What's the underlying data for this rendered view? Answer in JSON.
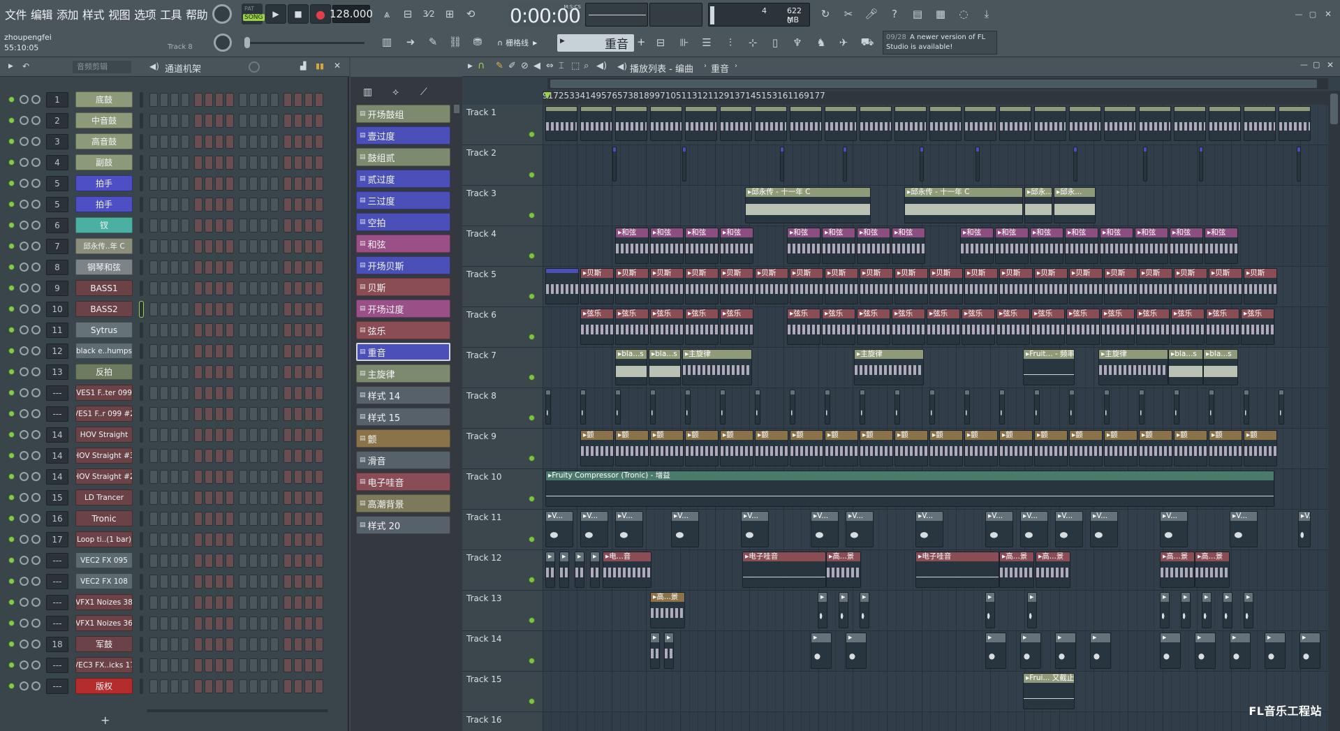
{
  "menu": [
    "文件",
    "编辑",
    "添加",
    "样式",
    "视图",
    "选项",
    "工具",
    "帮助"
  ],
  "transport": {
    "mode_label": "SONG",
    "tempo": "128.000",
    "time": "0:00:00",
    "time_unit": "M:S:CS",
    "cpu": "4",
    "mem": "622 MB",
    "poly": "0"
  },
  "project": {
    "user": "zhoupengfei",
    "elapsed": "55:10:05",
    "hint": "Track 8"
  },
  "toolbar2": {
    "snap": "栅格线",
    "pattern": "重音",
    "news_date": "09/28",
    "news_text_1": "A newer version of FL",
    "news_text_2": "Studio is available!"
  },
  "rack": {
    "filter": "音频剪辑",
    "title": "通道机架"
  },
  "channels": [
    {
      "num": "1",
      "name": "底鼓",
      "color": "#8c9a7a"
    },
    {
      "num": "2",
      "name": "中音鼓",
      "color": "#8c9a7a"
    },
    {
      "num": "3",
      "name": "高音鼓",
      "color": "#8c9a7a"
    },
    {
      "num": "4",
      "name": "副鼓",
      "color": "#8c9a7a"
    },
    {
      "num": "5",
      "name": "拍手",
      "color": "#4e4fc4"
    },
    {
      "num": "5",
      "name": "拍手",
      "color": "#4e4fc4"
    },
    {
      "num": "6",
      "name": "钗",
      "color": "#4bb0a2"
    },
    {
      "num": "7",
      "name": "邱永传..年 C",
      "color": "#8a8f7c"
    },
    {
      "num": "8",
      "name": "钢琴和弦",
      "color": "#7c8488"
    },
    {
      "num": "9",
      "name": "BASS1",
      "color": "#6b4347"
    },
    {
      "num": "10",
      "name": "BASS2",
      "color": "#6b4347"
    },
    {
      "num": "11",
      "name": "Sytrus",
      "color": "#657379"
    },
    {
      "num": "12",
      "name": "black e..humps",
      "color": "#5f6c71"
    },
    {
      "num": "13",
      "name": "反拍",
      "color": "#6f7b61"
    },
    {
      "num": "---",
      "name": "VES1 F..ter 099",
      "color": "#6b4347"
    },
    {
      "num": "---",
      "name": "VES1 F..r 099 #2",
      "color": "#6b4347"
    },
    {
      "num": "14",
      "name": "HOV Straight",
      "color": "#6b4347"
    },
    {
      "num": "14",
      "name": "HOV Straight #3",
      "color": "#6b4347"
    },
    {
      "num": "14",
      "name": "HOV Straight #2",
      "color": "#6b4347"
    },
    {
      "num": "15",
      "name": "LD Trancer",
      "color": "#6b4347"
    },
    {
      "num": "16",
      "name": "Tronic",
      "color": "#6b4347"
    },
    {
      "num": "17",
      "name": "Loop ti..(1 bar)",
      "color": "#6b4347"
    },
    {
      "num": "---",
      "name": "VEC2 FX 095",
      "color": "#5c6a70"
    },
    {
      "num": "---",
      "name": "VEC2 FX 108",
      "color": "#5c6a70"
    },
    {
      "num": "---",
      "name": "VFX1 Noizes 38",
      "color": "#6b4347"
    },
    {
      "num": "---",
      "name": "VFX1 Noizes 36",
      "color": "#6b4347"
    },
    {
      "num": "18",
      "name": "军鼓",
      "color": "#6b4347"
    },
    {
      "num": "---",
      "name": "VEC3 FX..icks 17",
      "color": "#6b4347"
    },
    {
      "num": "---",
      "name": "版权",
      "color": "#b52c2c"
    }
  ],
  "patterns": [
    {
      "name": "开场鼓组",
      "color": "#7c8a6f"
    },
    {
      "name": "壹过度",
      "color": "#4b4fb8"
    },
    {
      "name": "鼓组贰",
      "color": "#7c8a6f"
    },
    {
      "name": "贰过度",
      "color": "#4b4fb8"
    },
    {
      "name": "三过度",
      "color": "#4b4fb8"
    },
    {
      "name": "空拍",
      "color": "#4b4fb8"
    },
    {
      "name": "和弦",
      "color": "#9a4f86"
    },
    {
      "name": "开场贝斯",
      "color": "#4b4fb8"
    },
    {
      "name": "贝斯",
      "color": "#8a4c55"
    },
    {
      "name": "开场过度",
      "color": "#9a4f86"
    },
    {
      "name": "弦乐",
      "color": "#8a4c55"
    },
    {
      "name": "重音",
      "color": "#4b4fb8"
    },
    {
      "name": "主旋律",
      "color": "#7c8a6f"
    },
    {
      "name": "样式 14",
      "color": "#56616a"
    },
    {
      "name": "样式 15",
      "color": "#56616a"
    },
    {
      "name": "颤",
      "color": "#8a7348"
    },
    {
      "name": "滑音",
      "color": "#56616a"
    },
    {
      "name": "电子哇音",
      "color": "#8a4c55"
    },
    {
      "name": "高潮背景",
      "color": "#7c7a5b"
    },
    {
      "name": "样式 20",
      "color": "#56616a"
    }
  ],
  "playlist": {
    "title": "播放列表 - 编曲",
    "pattern": "重音"
  },
  "ruler": [
    "9",
    "17",
    "25",
    "33",
    "41",
    "49",
    "57",
    "65",
    "73",
    "81",
    "89",
    "97",
    "105",
    "113",
    "121",
    "129",
    "137",
    "145",
    "153",
    "161",
    "169",
    "177"
  ],
  "tracks": [
    "Track 1",
    "Track 2",
    "Track 3",
    "Track 4",
    "Track 5",
    "Track 6",
    "Track 7",
    "Track 8",
    "Track 9",
    "Track 10",
    "Track 11",
    "Track 12",
    "Track 13",
    "Track 14",
    "Track 15",
    "Track 16"
  ],
  "clip_labels": {
    "vocal": "邱永传 - 十一年 C",
    "vocal_short": "邱永...",
    "chord": "和弦",
    "bass": "贝斯",
    "strings": "弦乐",
    "melody": "主旋律",
    "black": "bla...s",
    "filter": "Fruit... - 频率",
    "tremolo": "颤",
    "comp": "Fruity Compressor (Tronic) - 增益",
    "wah": "电子哇音",
    "wah_short": "电...音",
    "high": "高...景",
    "cutoff": "Frui... 又截止",
    "v": "V..."
  },
  "watermark": "FL音乐工程站",
  "colors": {
    "clip_green": "#8f9a79",
    "clip_purple": "#8c4d80",
    "clip_blue": "#4b4fb8",
    "clip_red": "#8a4c55",
    "clip_gold": "#8a7348",
    "clip_teal": "#4a7a6a",
    "clip_grey": "#66727a"
  }
}
